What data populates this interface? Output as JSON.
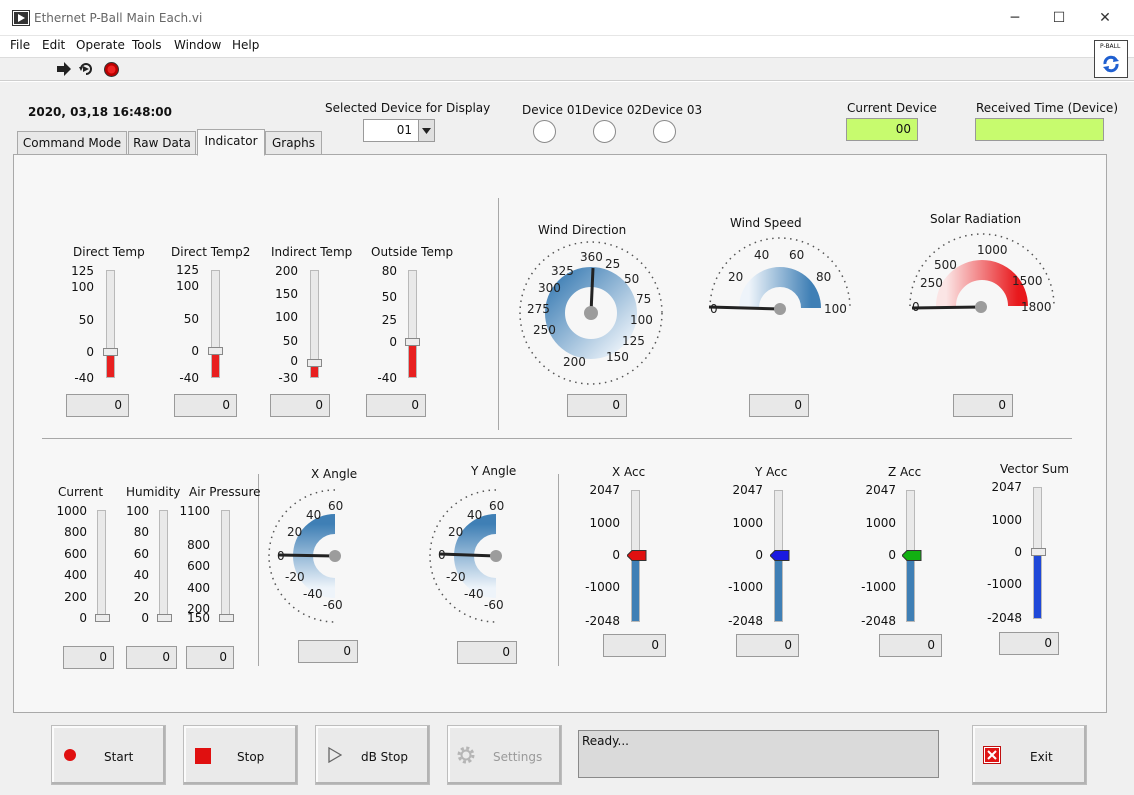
{
  "window": {
    "title": "Ethernet P-Ball Main Each.vi",
    "minimize": "─",
    "maximize": "☐",
    "close": "✕"
  },
  "menu": [
    "File",
    "Edit",
    "Operate",
    "Tools",
    "Window",
    "Help"
  ],
  "toolbar_badge": "P-BALL",
  "datetime": "2020, 03,18  16:48:00",
  "device_select": {
    "label": "Selected Device for Display",
    "value": "01"
  },
  "devices": [
    "Device 01",
    "Device 02",
    "Device 03"
  ],
  "current_device": {
    "label": "Current Device",
    "value": "00"
  },
  "received_time": {
    "label": "Received Time (Device)",
    "value": ""
  },
  "tabs": [
    "Command Mode",
    "Raw Data",
    "Indicator",
    "Graphs"
  ],
  "active_tab": "Indicator",
  "temps": [
    {
      "label": "Direct Temp",
      "ticks": [
        "125",
        "100",
        "50",
        "0",
        "-40"
      ],
      "value": "0",
      "fill_color": "#e82020"
    },
    {
      "label": "Direct Temp2",
      "ticks": [
        "125",
        "100",
        "50",
        "0",
        "-40"
      ],
      "value": "0",
      "fill_color": "#e82020"
    },
    {
      "label": "Indirect Temp",
      "ticks": [
        "200",
        "150",
        "100",
        "50",
        "0",
        "-30"
      ],
      "value": "0",
      "fill_color": "#e82020"
    },
    {
      "label": "Outside Temp",
      "ticks": [
        "80",
        "50",
        "25",
        "0",
        "-40"
      ],
      "value": "0",
      "fill_color": "#e82020"
    }
  ],
  "wind_direction": {
    "label": "Wind Direction",
    "ticks": [
      "360",
      "25",
      "50",
      "75",
      "100",
      "125",
      "150",
      "200",
      "250",
      "275",
      "300",
      "325"
    ],
    "value": "0"
  },
  "wind_speed": {
    "label": "Wind Speed",
    "ticks": [
      "0",
      "20",
      "40",
      "60",
      "80",
      "100"
    ],
    "value": "0"
  },
  "solar": {
    "label": "Solar Radiation",
    "ticks": [
      "0",
      "250",
      "500",
      "1000",
      "1500",
      "1800"
    ],
    "value": "0"
  },
  "env": [
    {
      "label": "Current",
      "ticks": [
        "1000",
        "800",
        "600",
        "400",
        "200",
        "0"
      ],
      "value": "0"
    },
    {
      "label": "Humidity",
      "ticks": [
        "100",
        "80",
        "60",
        "40",
        "20",
        "0"
      ],
      "value": "0"
    },
    {
      "label": "Air Pressure",
      "ticks": [
        "1100",
        "800",
        "600",
        "400",
        "200",
        "150"
      ],
      "value": "0"
    }
  ],
  "angles": [
    {
      "label": "X Angle",
      "ticks": [
        "60",
        "40",
        "20",
        "0",
        "-20",
        "-40",
        "-60"
      ],
      "value": "0"
    },
    {
      "label": "Y Angle",
      "ticks": [
        "60",
        "40",
        "20",
        "0",
        "-20",
        "-40",
        "-60"
      ],
      "value": "0"
    }
  ],
  "acc": [
    {
      "label": "X Acc",
      "ticks": [
        "2047",
        "1000",
        "0",
        "-1000",
        "-2048"
      ],
      "value": "0",
      "pointer_color": "#e01010"
    },
    {
      "label": "Y Acc",
      "ticks": [
        "2047",
        "1000",
        "0",
        "-1000",
        "-2048"
      ],
      "value": "0",
      "pointer_color": "#1a1ae0"
    },
    {
      "label": "Z Acc",
      "ticks": [
        "2047",
        "1000",
        "0",
        "-1000",
        "-2048"
      ],
      "value": "0",
      "pointer_color": "#12b012"
    }
  ],
  "vector_sum": {
    "label": "Vector Sum",
    "ticks": [
      "2047",
      "1000",
      "0",
      "-1000",
      "-2048"
    ],
    "value": "0"
  },
  "buttons": {
    "start": "Start",
    "stop": "Stop",
    "db_stop": "dB Stop",
    "settings": "Settings",
    "exit": "Exit"
  },
  "status": "Ready..."
}
